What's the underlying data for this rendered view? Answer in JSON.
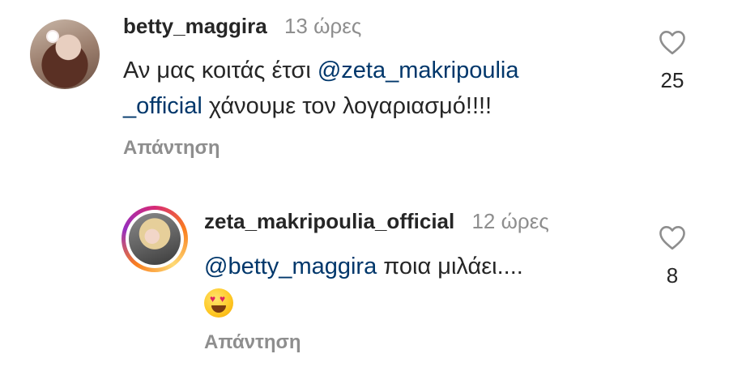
{
  "comments": [
    {
      "username": "betty_maggira",
      "time": "13 ώρες",
      "text_before": "Αν μας κοιτάς έτσι ",
      "mention_part1": "@zeta_makripoulia",
      "mention_part2": "_official",
      "text_after": " χάνουμε τον λογαριασμό!!!!",
      "reply_label": "Απάντηση",
      "likes": "25"
    },
    {
      "username": "zeta_makripoulia_official",
      "time": "12 ώρες",
      "mention": "@betty_maggira",
      "text_after": " ποια μιλάει....",
      "emoji": "smiling-face-with-heart-eyes",
      "reply_label": "Απάντηση",
      "likes": "8"
    }
  ],
  "colors": {
    "text": "#262626",
    "secondary": "#8e8e8e",
    "mention": "#00376b",
    "story_ring": [
      "#d62976",
      "#fa7e1e",
      "#feda75",
      "#962fbf"
    ]
  }
}
